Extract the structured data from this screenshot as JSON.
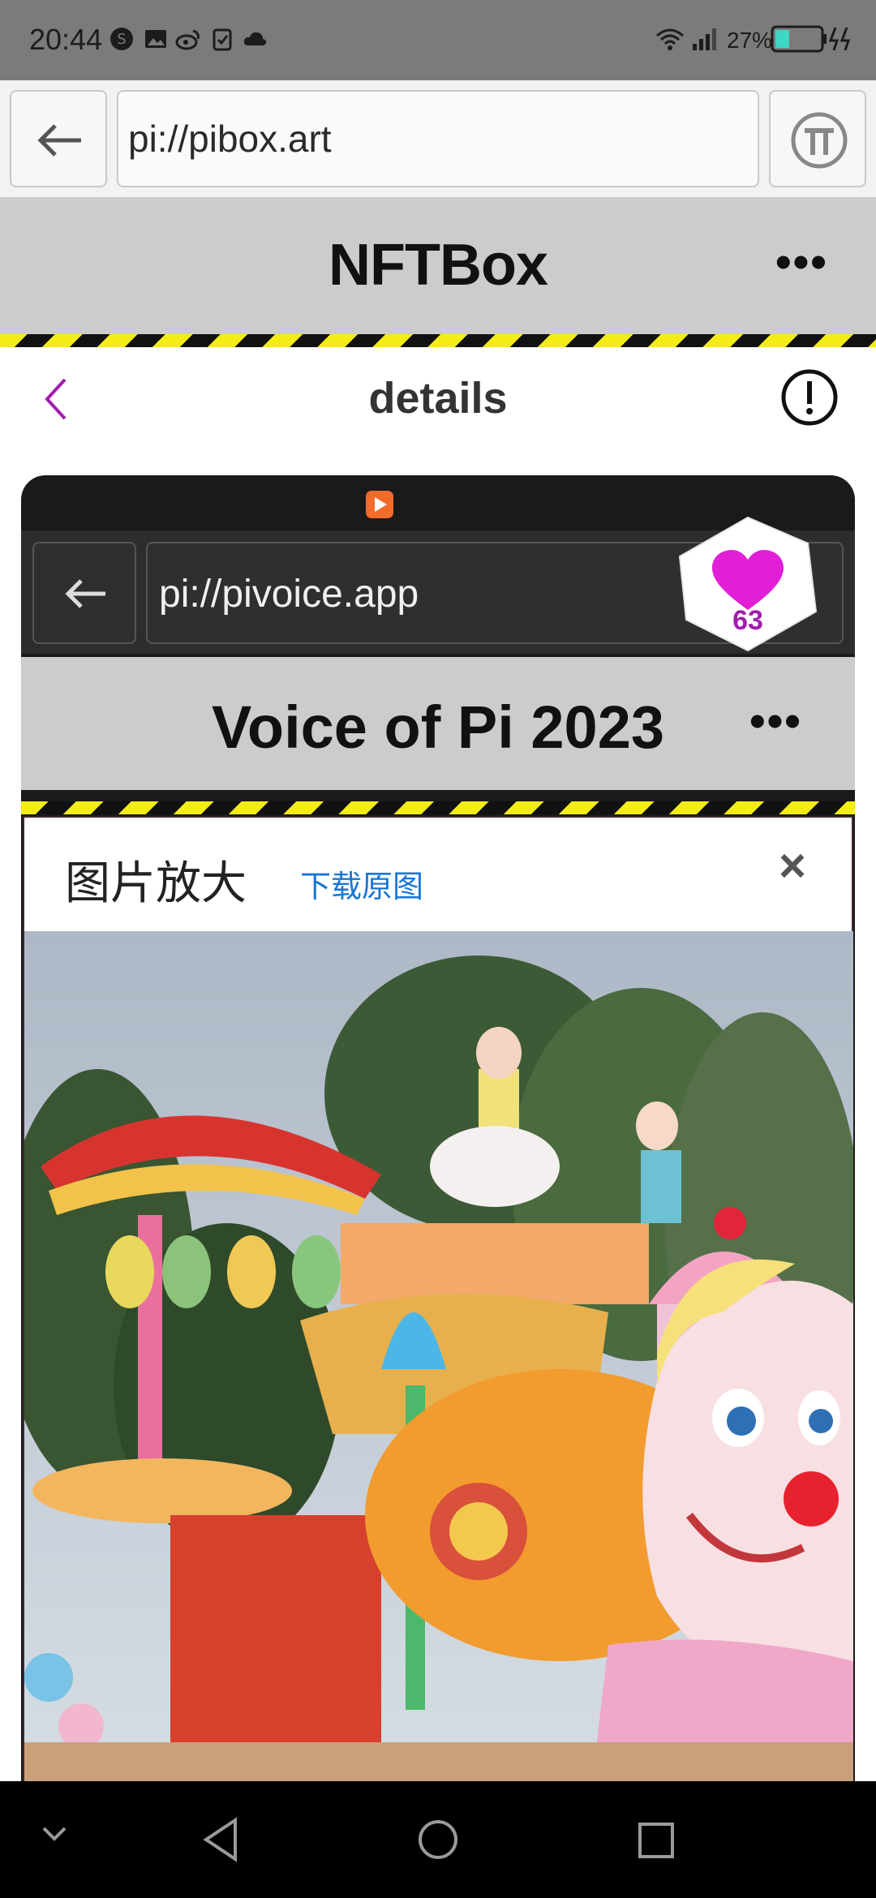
{
  "status_bar": {
    "time": "20:44",
    "battery_percent": "27%"
  },
  "browser": {
    "url": "pi://pibox.art"
  },
  "app": {
    "title": "NFTBox"
  },
  "details": {
    "title": "details"
  },
  "card": {
    "inner_url": "pi://pivoice.app",
    "inner_title": "Voice of Pi 2023",
    "modal_title": "图片放大",
    "download_label": "下载原图",
    "close_label": "×",
    "photo_alt": "photo"
  },
  "likes": {
    "count": "63"
  },
  "colors": {
    "accent_purple": "#a21caf",
    "heart": "#e01fd6",
    "link_blue": "#1976d2",
    "hazard_yellow": "#f3ec16"
  }
}
